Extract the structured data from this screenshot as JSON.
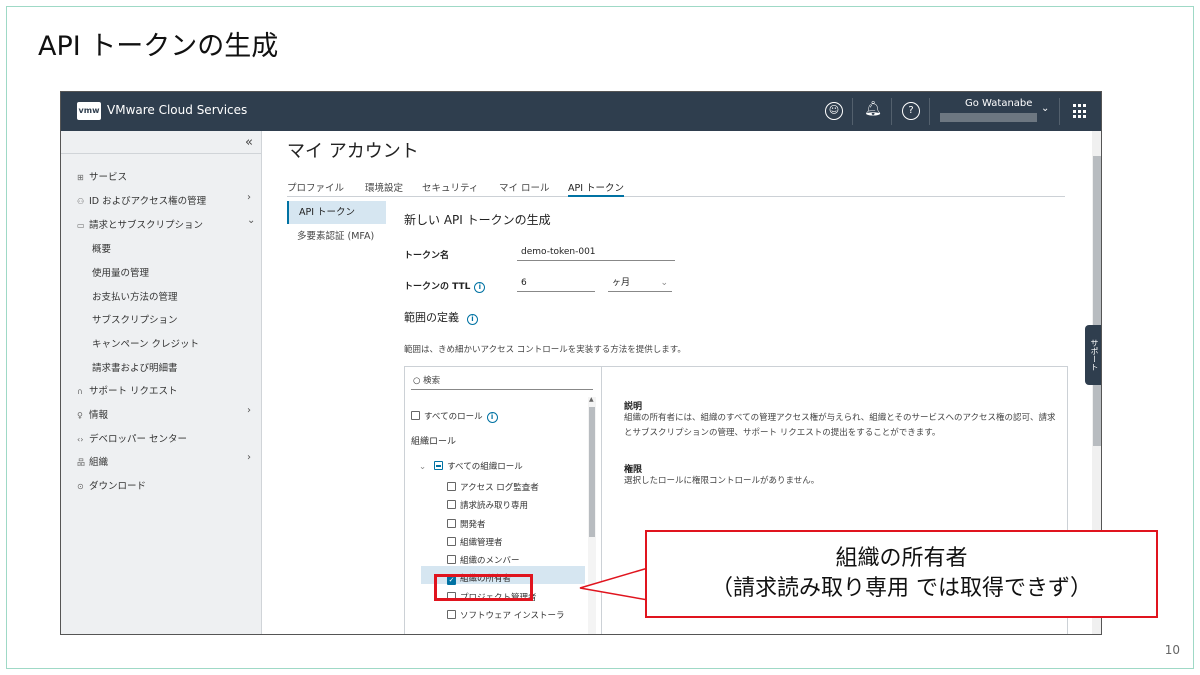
{
  "slide": {
    "title": "API トークンの生成",
    "page_number": "10"
  },
  "topbar": {
    "logo": "vmw",
    "brand": "VMware Cloud Services",
    "user_name": "Go Watanabe"
  },
  "sidebar": {
    "collapse": "«",
    "items": [
      {
        "icon": "⊞",
        "label": "サービス"
      },
      {
        "icon": "⚇",
        "label": "ID およびアクセス権の管理",
        "arrow": "›"
      },
      {
        "icon": "▭",
        "label": "請求とサブスクリプション",
        "arrow": "⌄"
      },
      {
        "label": "概要"
      },
      {
        "label": "使用量の管理"
      },
      {
        "label": "お支払い方法の管理"
      },
      {
        "label": "サブスクリプション"
      },
      {
        "label": "キャンペーン クレジット"
      },
      {
        "label": "請求書および明細書"
      },
      {
        "icon": "∩",
        "label": "サポート リクエスト"
      },
      {
        "icon": "♀",
        "label": "情報",
        "arrow": "›"
      },
      {
        "icon": "‹›",
        "label": "デベロッパー センター"
      },
      {
        "icon": "品",
        "label": "組織",
        "arrow": "›"
      },
      {
        "icon": "⊙",
        "label": "ダウンロード"
      }
    ]
  },
  "main": {
    "page_title": "マイ アカウント",
    "tabs": [
      "プロファイル",
      "環境設定",
      "セキュリティ",
      "マイ ロール",
      "API トークン"
    ],
    "subnav": [
      "API トークン",
      "多要素認証 (MFA)"
    ],
    "form_title": "新しい API トークンの生成",
    "token_name_label": "トークン名",
    "token_name_value": "demo-token-001",
    "ttl_label": "トークンの TTL",
    "ttl_value": "6",
    "ttl_unit": "ヶ月",
    "scope_title": "範囲の定義",
    "scope_desc": "範囲は、きめ細かいアクセス コントロールを実装する方法を提供します。",
    "search_placeholder": "検索",
    "all_roles": "すべてのロール",
    "org_roles_heading": "組織ロール",
    "all_org_roles": "すべての組織ロール",
    "roles": [
      {
        "label": "アクセス ログ監査者",
        "checked": false
      },
      {
        "label": "請求読み取り専用",
        "checked": false
      },
      {
        "label": "開発者",
        "checked": false
      },
      {
        "label": "組織管理者",
        "checked": false
      },
      {
        "label": "組織のメンバー",
        "checked": false
      },
      {
        "label": "組織の所有者",
        "checked": true
      },
      {
        "label": "プロジェクト管理者",
        "checked": false
      },
      {
        "label": "ソフトウェア インストーラ",
        "checked": false
      }
    ],
    "desc_heading": "説明",
    "desc_text": "組織の所有者には、組織のすべての管理アクセス権が与えられ、組織とそのサービスへのアクセス権の認可、請求とサブスクリプションの管理、サポート リクエストの提出をすることができます。",
    "perm_heading": "権限",
    "perm_text": "選択したロールに権限コントロールがありません。",
    "support_tab": "サポート"
  },
  "callout": {
    "line1": "組織の所有者",
    "line2": "（請求読み取り専用 では取得できず）"
  },
  "colors": {
    "topbar": "#2f3e4e",
    "accent": "#0072a3",
    "highlight_red": "#e0141e"
  }
}
